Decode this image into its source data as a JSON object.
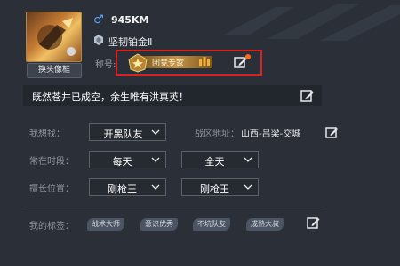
{
  "profile": {
    "change_frame_label": "换头像框",
    "gender_symbol": "♂",
    "distance": "945KM",
    "rank": "坚韧铂金Ⅱ",
    "rank_icon": "rank-icon",
    "title_label": "称号:",
    "title_badge": "团竞专家",
    "slogan": "既然苍井已成空，余生唯有洪真英！"
  },
  "form": {
    "looking_for_label": "我想找：",
    "looking_for_value": "开黑队友",
    "region_label": "战区地址：",
    "region_value": "山西-吕梁-交城",
    "online_label": "常在时段：",
    "online_day": "每天",
    "online_time": "全天",
    "position_label": "擅长位置：",
    "position_1": "刚枪王",
    "position_2": "刚枪王"
  },
  "tags": {
    "label": "我的标签：",
    "items": [
      "战术大师",
      "意识优秀",
      "不坑队友",
      "成熟大叔"
    ]
  },
  "colors": {
    "background": "#2b3038",
    "highlight_box": "#e02020",
    "gender": "#5aa7ff",
    "badge_gold": "#c49446",
    "notification": "#ff6a1a"
  }
}
